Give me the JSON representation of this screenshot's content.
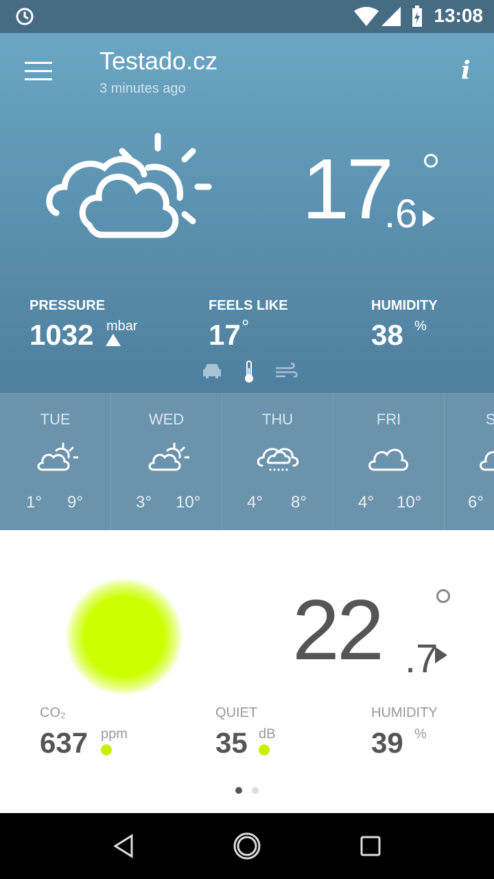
{
  "status_bar": {
    "time": "13:08"
  },
  "header": {
    "title": "Testado.cz",
    "updated": "3 minutes ago",
    "info_label": "i"
  },
  "outdoor": {
    "temp_int": "17",
    "temp_dec": ".6",
    "stats": [
      {
        "label": "PRESSURE",
        "value": "1032",
        "unit": "mbar"
      },
      {
        "label": "FEELS LIKE",
        "value": "17",
        "unit": "°"
      },
      {
        "label": "HUMIDITY",
        "value": "38",
        "unit": "%"
      }
    ]
  },
  "forecast": [
    {
      "day": "TUE",
      "lo": "1°",
      "hi": "9°",
      "icon": "partly-cloudy-icon"
    },
    {
      "day": "WED",
      "lo": "3°",
      "hi": "10°",
      "icon": "partly-cloudy-icon"
    },
    {
      "day": "THU",
      "lo": "4°",
      "hi": "8°",
      "icon": "cloud-drizzle-icon"
    },
    {
      "day": "FRI",
      "lo": "4°",
      "hi": "10°",
      "icon": "cloud-icon"
    },
    {
      "day": "SAT",
      "lo": "6°",
      "hi": "",
      "icon": "cloud-icon"
    }
  ],
  "indoor": {
    "temp_int": "22",
    "temp_dec": ".7",
    "stats": [
      {
        "label": "CO₂",
        "value": "637",
        "unit": "ppm"
      },
      {
        "label": "QUIET",
        "value": "35",
        "unit": "dB"
      },
      {
        "label": "HUMIDITY",
        "value": "39",
        "unit": "%"
      }
    ]
  },
  "colors": {
    "accent_green": "#c6f000",
    "sky_top": "#6aa6c3",
    "forecast_bg": "#6b93ab"
  }
}
